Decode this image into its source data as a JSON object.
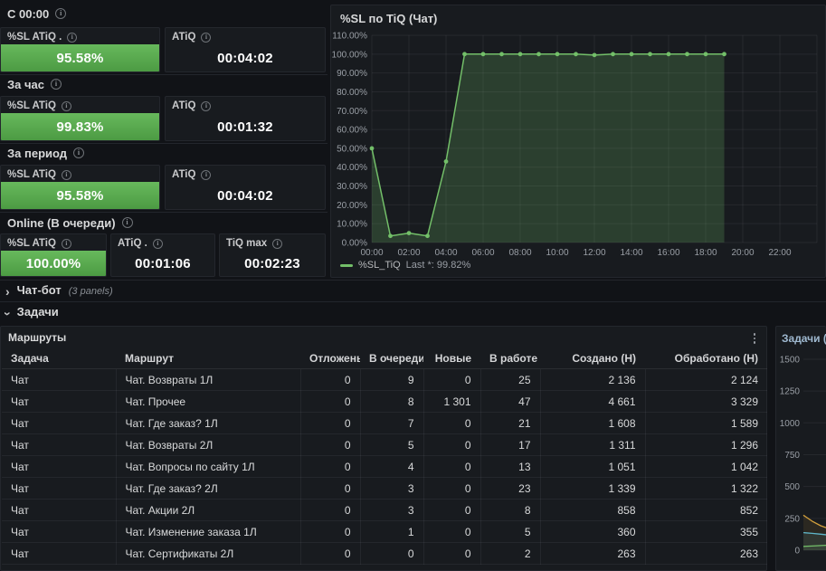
{
  "theme": {
    "green": "#73bf69",
    "green_fill": "rgba(115,191,105,0.22)",
    "bar_green_top": "#67b95c",
    "bar_green_bottom": "#4c9b43",
    "yellow": "#d3a03c",
    "teal": "#5fb6c9",
    "grid": "rgba(204,204,220,0.08)",
    "tick_text": "#9a9fa6"
  },
  "sections": [
    {
      "label": "С 00:00",
      "panels": [
        {
          "title": "%SL ATiQ .",
          "kind": "bar",
          "value": "95.58%"
        },
        {
          "title": "ATiQ",
          "kind": "text",
          "value": "00:04:02"
        }
      ]
    },
    {
      "label": "За час",
      "panels": [
        {
          "title": "%SL ATiQ",
          "kind": "bar",
          "value": "99.83%"
        },
        {
          "title": "ATiQ",
          "kind": "text",
          "value": "00:01:32"
        }
      ]
    },
    {
      "label": "За период",
      "panels": [
        {
          "title": "%SL ATiQ",
          "kind": "bar",
          "value": "95.58%"
        },
        {
          "title": "ATiQ",
          "kind": "text",
          "value": "00:04:02"
        }
      ]
    },
    {
      "label": "Online (В очереди)",
      "panels": [
        {
          "title": "%SL ATiQ",
          "kind": "bar",
          "value": "100.00%"
        },
        {
          "title": "ATiQ .",
          "kind": "text",
          "value": "00:01:06"
        },
        {
          "title": "TiQ max",
          "kind": "text",
          "value": "00:02:23"
        }
      ]
    }
  ],
  "sl_panel": {
    "title": "%SL по TiQ (Чат)",
    "legend_series": "%SL_TiQ",
    "legend_stat": "Last *: 99.82%"
  },
  "rows": {
    "chatbot_label": "Чат-бот",
    "chatbot_note": "(3 panels)",
    "tasks_label": "Задачи"
  },
  "routes_panel": {
    "title": "Маршруты",
    "sort_arrow": "↓",
    "columns": [
      {
        "label": "Задача",
        "align": "left"
      },
      {
        "label": "Маршрут",
        "align": "left"
      },
      {
        "label": "Отложены",
        "align": "right"
      },
      {
        "label": "В очереди",
        "align": "right",
        "sorted": true
      },
      {
        "label": "Новые",
        "align": "right"
      },
      {
        "label": "В работе",
        "align": "right"
      },
      {
        "label": "Создано (Н)",
        "align": "right"
      },
      {
        "label": "Обработано (Н)",
        "align": "right"
      }
    ],
    "rows": [
      [
        "Чат",
        "Чат. Возвраты 1Л",
        "0",
        "9",
        "0",
        "25",
        "2 136",
        "2 124"
      ],
      [
        "Чат",
        "Чат. Прочее",
        "0",
        "8",
        "1 301",
        "47",
        "4 661",
        "3 329"
      ],
      [
        "Чат",
        "Чат. Где заказ? 1Л",
        "0",
        "7",
        "0",
        "21",
        "1 608",
        "1 589"
      ],
      [
        "Чат",
        "Чат. Возвраты 2Л",
        "0",
        "5",
        "0",
        "17",
        "1 311",
        "1 296"
      ],
      [
        "Чат",
        "Чат. Вопросы по сайту 1Л",
        "0",
        "4",
        "0",
        "13",
        "1 051",
        "1 042"
      ],
      [
        "Чат",
        "Чат. Где заказ? 2Л",
        "0",
        "3",
        "0",
        "23",
        "1 339",
        "1 322"
      ],
      [
        "Чат",
        "Чат. Акции 2Л",
        "0",
        "3",
        "0",
        "8",
        "858",
        "852"
      ],
      [
        "Чат",
        "Чат. Изменение заказа 1Л",
        "0",
        "1",
        "0",
        "5",
        "360",
        "355"
      ],
      [
        "Чат",
        "Чат. Сертификаты 2Л",
        "0",
        "0",
        "0",
        "2",
        "263",
        "263"
      ]
    ]
  },
  "tasks_panel": {
    "title": "Задачи (Чат)"
  },
  "chart_data": [
    {
      "id": "sl_tiq",
      "type": "area",
      "title": "%SL по TiQ (Чат)",
      "x": [
        "00:00",
        "01:00",
        "02:00",
        "03:00",
        "04:00",
        "05:00",
        "06:00",
        "07:00",
        "08:00",
        "09:00",
        "10:00",
        "11:00",
        "12:00",
        "13:00",
        "14:00",
        "15:00",
        "16:00",
        "17:00",
        "18:00",
        "19:00"
      ],
      "values": [
        50,
        3.5,
        5,
        3.5,
        43,
        100,
        100,
        100,
        100,
        100,
        100,
        100,
        99.5,
        100,
        100,
        100,
        100,
        100,
        100,
        100
      ],
      "ylim": [
        0,
        110
      ],
      "ytick_values": [
        0,
        10,
        20,
        30,
        40,
        50,
        60,
        70,
        80,
        90,
        100,
        110
      ],
      "ytick_labels": [
        "0.00%",
        "10.00%",
        "20.00%",
        "30.00%",
        "40.00%",
        "50.00%",
        "60.00%",
        "70.00%",
        "80.00%",
        "90.00%",
        "100.00%",
        "110.00%"
      ],
      "xtick_labels": [
        "00:00",
        "02:00",
        "04:00",
        "06:00",
        "08:00",
        "10:00",
        "12:00",
        "14:00",
        "16:00",
        "18:00",
        "20:00",
        "22:00"
      ],
      "legend": "%SL_TiQ",
      "last_value": "99.82%",
      "grid": true,
      "legend_position": "bottom"
    },
    {
      "id": "tasks_mini",
      "type": "line",
      "title": "Задачи (Чат)",
      "ylim": [
        0,
        1500
      ],
      "ytick_values": [
        0,
        250,
        500,
        750,
        1000,
        1250,
        1500
      ],
      "ytick_labels": [
        "0",
        "250",
        "500",
        "750",
        "1000",
        "1250",
        "1500"
      ],
      "series": [
        {
          "name": "series-1",
          "color": "#d3a03c",
          "values": [
            275,
            228,
            192,
            168,
            155,
            148
          ]
        },
        {
          "name": "series-2",
          "color": "#5fb6c9",
          "values": [
            138,
            132,
            126,
            118,
            112,
            108
          ]
        },
        {
          "name": "series-3",
          "color": "#73bf69",
          "values": [
            30,
            33,
            36,
            39,
            41,
            43
          ]
        }
      ],
      "grid": true
    }
  ]
}
